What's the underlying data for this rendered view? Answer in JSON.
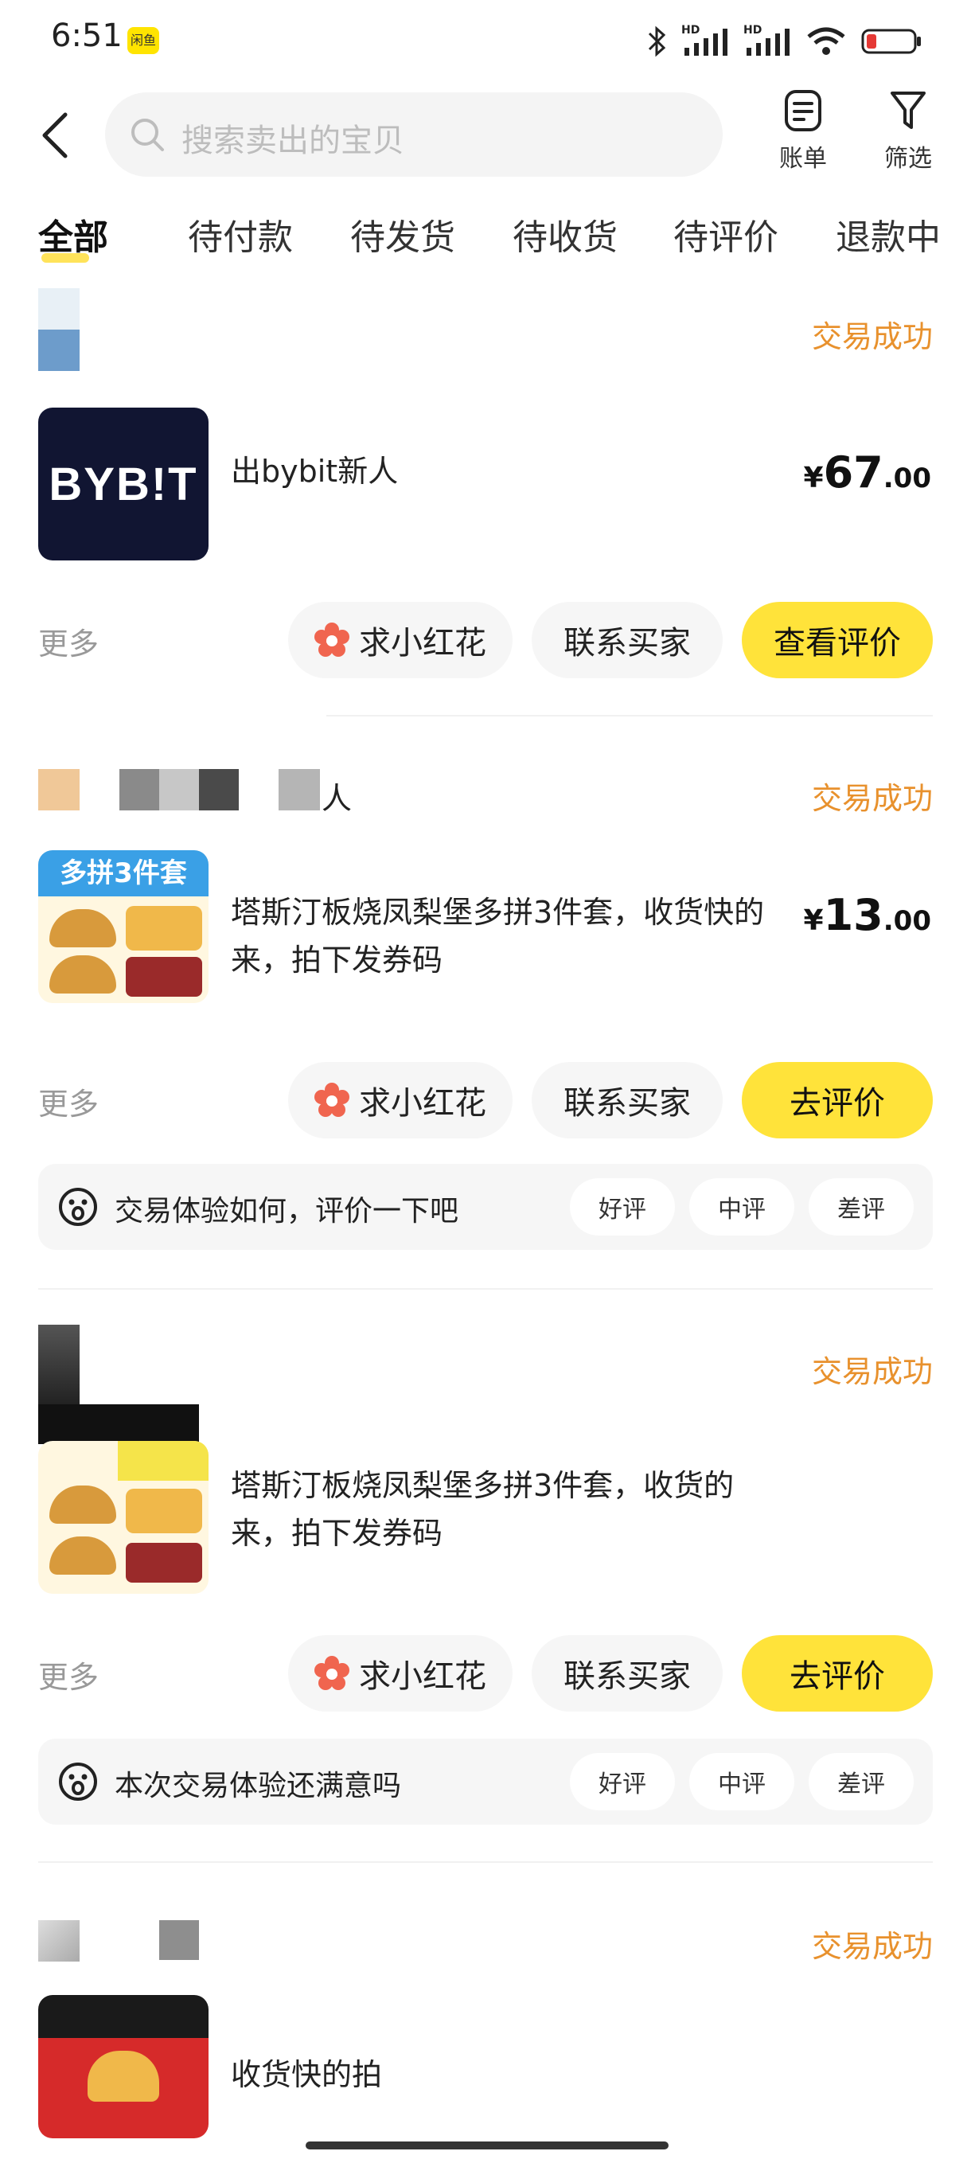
{
  "status_bar": {
    "time": "6:51",
    "app_badge": "闲鱼",
    "hd1": "HD",
    "hd2": "HD"
  },
  "header": {
    "search_placeholder": "搜索卖出的宝贝",
    "bill_label": "账单",
    "filter_label": "筛选"
  },
  "tabs": [
    "全部",
    "待付款",
    "待发货",
    "待收货",
    "待评价",
    "退款中"
  ],
  "orders": [
    {
      "status": "交易成功",
      "thumb_text": "BYB!T",
      "title": "出bybit新人",
      "price_currency": "¥",
      "price_int": "67",
      "price_dec": ".00",
      "more": "更多",
      "btn_flower": "求小红花",
      "btn_contact": "联系买家",
      "btn_main": "查看评价"
    },
    {
      "buyer_suffix": "人",
      "status": "交易成功",
      "thumb_banner": "多拼3件套",
      "title": "塔斯汀板烧凤梨堡多拼3件套，收货快的来，拍下发券码",
      "price_currency": "¥",
      "price_int": "13",
      "price_dec": ".00",
      "more": "更多",
      "btn_flower": "求小红花",
      "btn_contact": "联系买家",
      "btn_main": "去评价",
      "review_prompt": "交易体验如何，评价一下吧",
      "chips": [
        "好评",
        "中评",
        "差评"
      ]
    },
    {
      "status": "交易成功",
      "title": "塔斯汀板烧凤梨堡多拼3件套，收货的来，拍下发券码",
      "more": "更多",
      "btn_flower": "求小红花",
      "btn_contact": "联系买家",
      "btn_main": "去评价",
      "review_prompt": "本次交易体验还满意吗",
      "chips": [
        "好评",
        "中评",
        "差评"
      ]
    },
    {
      "status": "交易成功",
      "title": "收货快的拍"
    }
  ],
  "colors": {
    "accent_yellow": "#ffe33a",
    "status_orange": "#e8912d"
  }
}
